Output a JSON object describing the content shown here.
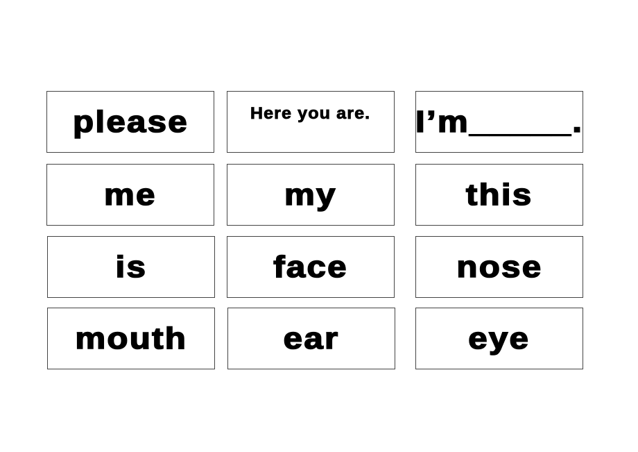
{
  "cards": [
    "please",
    "Here you are.",
    "I’m_____.",
    "me",
    "my",
    "this",
    "is",
    "face",
    "nose",
    "mouth",
    "ear",
    "eye"
  ]
}
